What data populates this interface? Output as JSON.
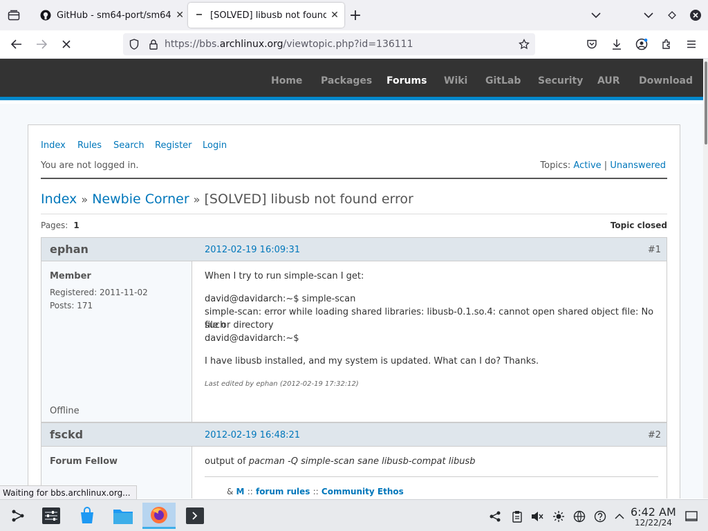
{
  "browser": {
    "tabs": [
      {
        "title": "GitHub - sm64-port/sm64-",
        "close": "✕"
      },
      {
        "title": "[SOLVED] libusb not found",
        "close": "✕"
      }
    ],
    "new_tab": "+",
    "url_prefix": "https://bbs.",
    "url_domain": "archlinux.org",
    "url_path": "/viewtopic.php?id=136111",
    "status": "Waiting for bbs.archlinux.org..."
  },
  "archnav": [
    "Home",
    "Packages",
    "Forums",
    "Wiki",
    "GitLab",
    "Security",
    "AUR",
    "Download"
  ],
  "forum": {
    "menu": [
      "Index",
      "Rules",
      "Search",
      "Register",
      "Login"
    ],
    "status": "You are not logged in.",
    "topics_label": "Topics:",
    "topics_active": "Active",
    "topics_sep": "|",
    "topics_unanswered": "Unanswered",
    "crumb_index": "Index",
    "crumb_sep": "»",
    "crumb_forum": "Newbie Corner",
    "crumb_topic": "[SOLVED] libusb not found error",
    "pages_label": "Pages:",
    "pages_value": "1",
    "topic_closed": "Topic closed"
  },
  "posts": [
    {
      "author": "ephan",
      "date": "2012-02-19 16:09:31",
      "num": "#1",
      "role": "Member",
      "registered": "Registered: 2011-11-02",
      "posts": "Posts: 171",
      "status": "Offline",
      "lines": [
        "When I try to run simple-scan I get:",
        "david@davidarch:~$ simple-scan",
        "simple-scan: error while loading shared libraries: libusb-0.1.so.4: cannot open shared object file: No such",
        "file or directory",
        "david@davidarch:~$",
        "I have libusb installed, and my system is updated. What can I do? Thanks."
      ],
      "edited": "Last edited by ephan (2012-02-19 17:32:12)"
    },
    {
      "author": "fsckd",
      "date": "2012-02-19 16:48:21",
      "num": "#2",
      "role": "Forum Fellow",
      "text_prefix": "output of",
      "text_cmd": "pacman -Q simple-scan sane libusb-compat libusb"
    }
  ],
  "footer": {
    "partial": "&",
    "m": "M",
    "sep": "::",
    "rules": "forum rules",
    "ethos": "Community Ethos"
  },
  "taskbar": {
    "time": "6:42 AM",
    "date": "12/22/24"
  }
}
